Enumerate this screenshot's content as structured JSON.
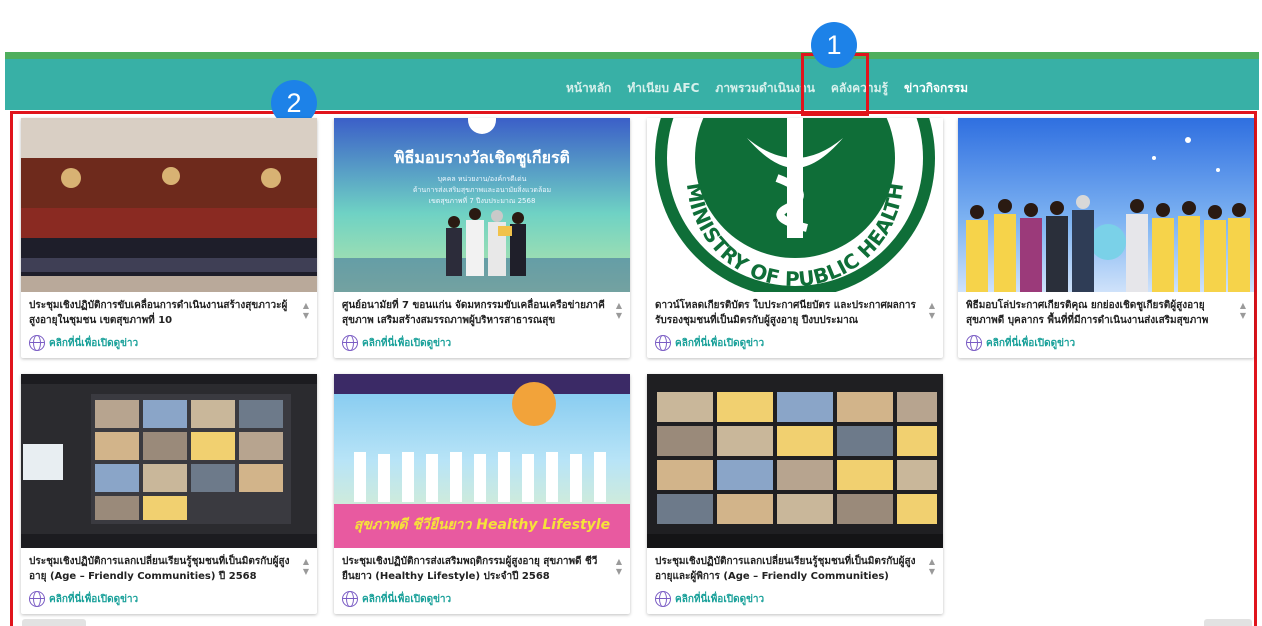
{
  "nav": {
    "items": [
      {
        "label": "หน้าหลัก",
        "active": false
      },
      {
        "label": "ทำเนียบ AFC",
        "active": false
      },
      {
        "label": "ภาพรวมดำเนินงาน",
        "active": false
      },
      {
        "label": "คลังความรู้",
        "active": false
      },
      {
        "label": "ข่าวกิจกรรม",
        "active": true
      }
    ]
  },
  "markers": {
    "one": "1",
    "two": "2"
  },
  "poster": {
    "heading": "พิธีมอบรางวัลเชิดชูเกียรติ",
    "sub1": "บุคคล หน่วยงาน/องค์กรดีเด่น",
    "sub2": "ด้านการส่งเสริมสุขภาพและอนามัยสิ่งแวดล้อม",
    "sub3": "เขตสุขภาพที่ 7 ปีงบประมาณ 2568"
  },
  "seal_text": "MINISTRY OF PUBLIC HEALTH",
  "banner_text": "สุขภาพดี ชีวียืนยาว Healthy Lifestyle",
  "link_label": "คลิกที่นี่เพื่อเปิดดูข่าว",
  "cards": [
    {
      "title": "ประชุมเชิงปฏิบัติการขับเคลื่อนการดำเนินงานสร้างสุขภาวะผู้สูงอายุในชุมชน เขตสุขภาพที่ 10"
    },
    {
      "title": "ศูนย์อนามัยที่ 7 ขอนแก่น จัดมหกรรมขับเคลื่อนเครือข่ายภาคีสุขภาพ เสริมสร้างสมรรถภาพผู้บริหารสาธารณสุข"
    },
    {
      "title": "ดาวน์โหลดเกียรติบัตร ใบประกาศนียบัตร และประกาศผลการรับรองชุมชนที่เป็นมิตรกับผู้สูงอายุ ปีงบประมาณ"
    },
    {
      "title": "พิธีมอบโล่ประกาศเกียรติคุณ ยกย่องเชิดชูเกียรติผู้สูงอายุสุขภาพดี บุคลากร พื้นที่ที่มีการดำเนินงานส่งเสริมสุขภาพ"
    },
    {
      "title": "ประชุมเชิงปฏิบัติการแลกเปลี่ยนเรียนรู้ชุมชนที่เป็นมิตรกับผู้สูงอายุ (Age – Friendly Communities) ปี 2568"
    },
    {
      "title": "ประชุมเชิงปฏิบัติการส่งเสริมพฤติกรรมผู้สูงอายุ สุขภาพดี ชีวียืนยาว (Healthy Lifestyle) ประจำปี 2568"
    },
    {
      "title": "ประชุมเชิงปฏิบัติการแลกเปลี่ยนเรียนรู้ชุมชนที่เป็นมิตรกับผู้สูงอายุและผู้พิการ (Age – Friendly Communities)"
    }
  ],
  "colors": {
    "nav_bg": "#38b0a6",
    "nav_top": "#4fae5d",
    "highlight": "#e0141c",
    "marker": "#1d82e8",
    "link": "#1aa19a"
  }
}
